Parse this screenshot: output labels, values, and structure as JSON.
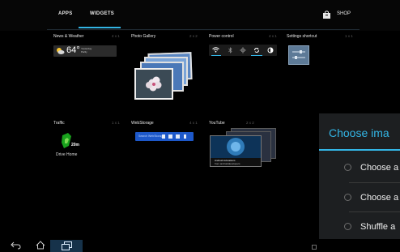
{
  "tabs": [
    {
      "label": "APPS",
      "selected": false
    },
    {
      "label": "WIDGETS",
      "selected": true
    }
  ],
  "shop": {
    "label": "SHOP",
    "icon": "shop-bag-icon"
  },
  "widgets": [
    {
      "title": "News & Weather",
      "size": "4 x 1"
    },
    {
      "title": "Photo Gallery",
      "size": "2 x 2"
    },
    {
      "title": "Power control",
      "size": "4 x 1"
    },
    {
      "title": "Settings shortcut",
      "size": "1 x 1"
    },
    {
      "title": "Traffic",
      "size": "1 x 1"
    },
    {
      "title": "WebStorage",
      "size": "4 x 1"
    },
    {
      "title": "YouTube",
      "size": "2 x 2"
    }
  ],
  "weather": {
    "temp": "64°",
    "line1": "Yesterday",
    "line2": "Partly"
  },
  "traffic": {
    "value": "20m",
    "label": "Drive Home"
  },
  "webstorage": {
    "text": "Search WebStorage"
  },
  "youtube": {
    "caption_line1": "Android Activations",
    "caption_line2": "from androiddevelopers"
  },
  "dialog": {
    "title": "Choose ima",
    "options": [
      "Choose a",
      "Choose a",
      "Shuffle a"
    ]
  },
  "colors": {
    "accent": "#33b5e5",
    "background": "#000000",
    "dialog_bg": "#1d1f21"
  }
}
